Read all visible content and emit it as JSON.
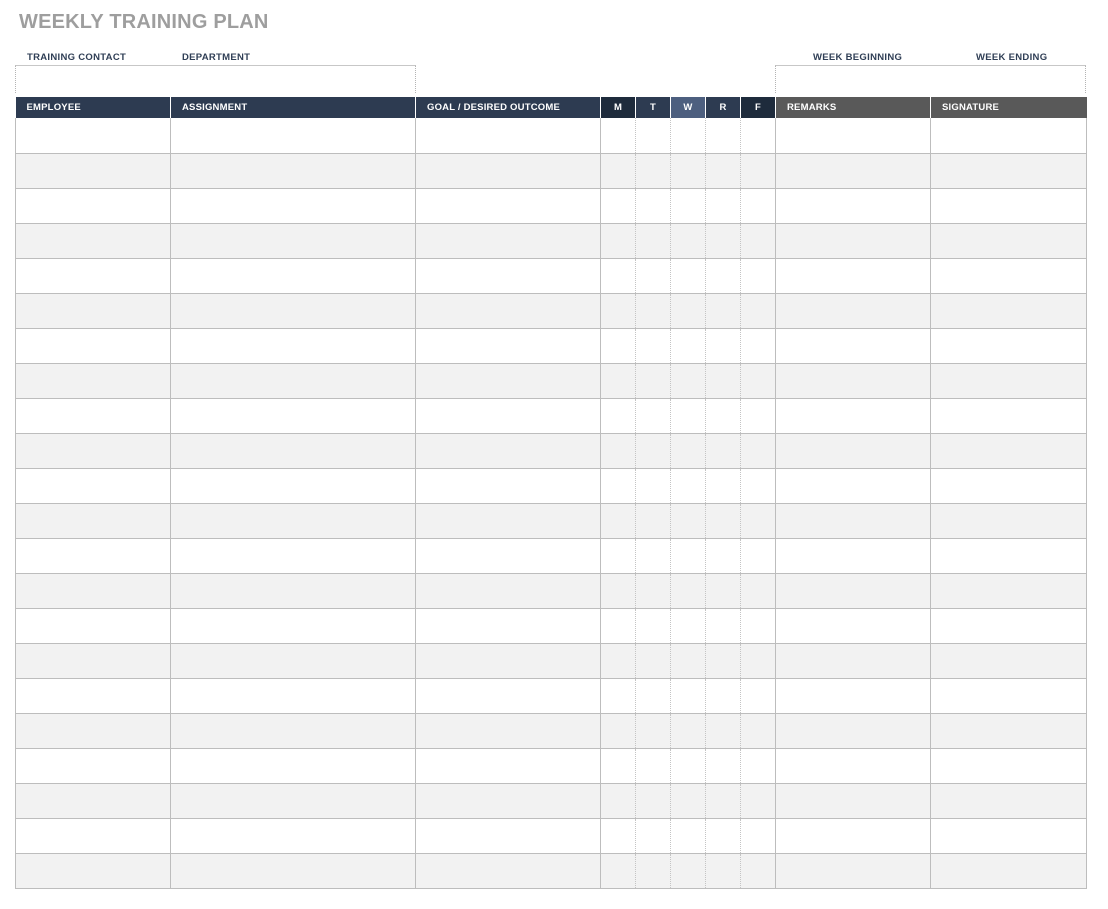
{
  "title": "WEEKLY TRAINING PLAN",
  "info": {
    "training_contact_label": "TRAINING CONTACT",
    "department_label": "DEPARTMENT",
    "week_beginning_label": "WEEK BEGINNING",
    "week_ending_label": "WEEK ENDING"
  },
  "table": {
    "headers": {
      "employee": "EMPLOYEE",
      "assignment": "ASSIGNMENT",
      "goal": "GOAL / DESIRED OUTCOME",
      "mon": "M",
      "tue": "T",
      "wed": "W",
      "thu": "R",
      "fri": "F",
      "remarks": "REMARKS",
      "signature": "SIGNATURE"
    },
    "row_count": 22
  },
  "colors": {
    "title": "#9e9e9e",
    "header_dark": "#2d3b51",
    "header_navy": "#1e2b3c",
    "header_wed": "#4d5f7f",
    "header_gray": "#595959",
    "row_alt": "#f2f2f2",
    "grid": "#bdbdbd"
  }
}
